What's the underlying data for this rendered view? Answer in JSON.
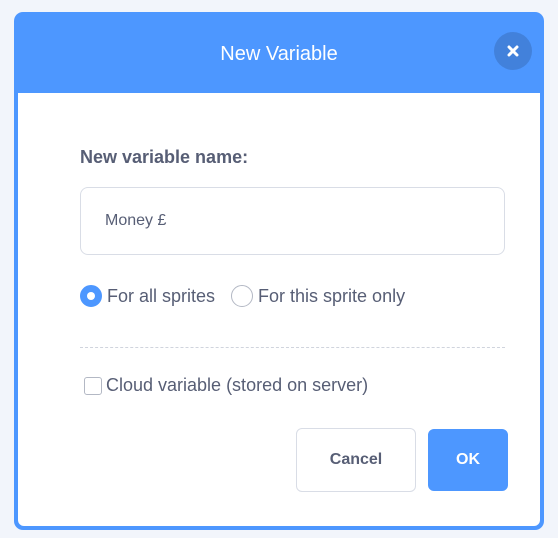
{
  "dialog": {
    "title": "New Variable",
    "close_icon": "close-icon"
  },
  "form": {
    "prompt_label": "New variable name:",
    "name_input": {
      "value": "Money £",
      "placeholder": ""
    },
    "scope_options": [
      {
        "label": "For all sprites",
        "selected": true
      },
      {
        "label": "For this sprite only",
        "selected": false
      }
    ],
    "cloud_option": {
      "label": "Cloud variable (stored on server)",
      "checked": false
    }
  },
  "buttons": {
    "cancel_label": "Cancel",
    "ok_label": "OK"
  },
  "colors": {
    "accent": "#4d97ff",
    "text": "#575e75",
    "border": "#d9dde6"
  }
}
